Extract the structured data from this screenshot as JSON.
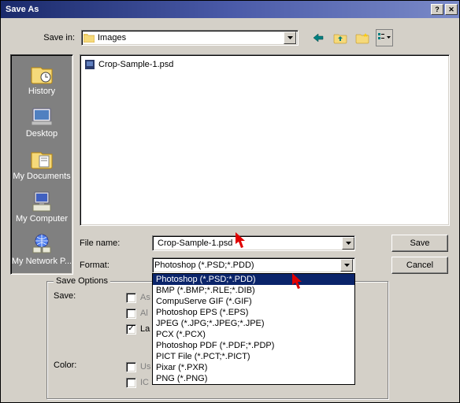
{
  "title": "Save As",
  "savein": {
    "label": "Save in:",
    "value": "Images"
  },
  "places": [
    "History",
    "Desktop",
    "My Documents",
    "My Computer",
    "My Network P..."
  ],
  "file_list": [
    "Crop-Sample-1.psd"
  ],
  "filename": {
    "label": "File name:",
    "value": "Crop-Sample-1.psd"
  },
  "format": {
    "label": "Format:",
    "value": "Photoshop (*.PSD;*.PDD)"
  },
  "format_options": [
    "Photoshop (*.PSD;*.PDD)",
    "BMP (*.BMP;*.RLE;*.DIB)",
    "CompuServe GIF (*.GIF)",
    "Photoshop EPS (*.EPS)",
    "JPEG (*.JPG;*.JPEG;*.JPE)",
    "PCX (*.PCX)",
    "Photoshop PDF (*.PDF;*.PDP)",
    "PICT File (*.PCT;*.PICT)",
    "Pixar (*.PXR)",
    "PNG (*.PNG)"
  ],
  "format_selected_index": 0,
  "buttons": {
    "save": "Save",
    "cancel": "Cancel"
  },
  "save_options": {
    "legend": "Save Options",
    "save_label": "Save:",
    "as": "As",
    "al": "Al",
    "layers": "La",
    "color_label": "Color:",
    "us": "Us",
    "icc": "IC"
  }
}
